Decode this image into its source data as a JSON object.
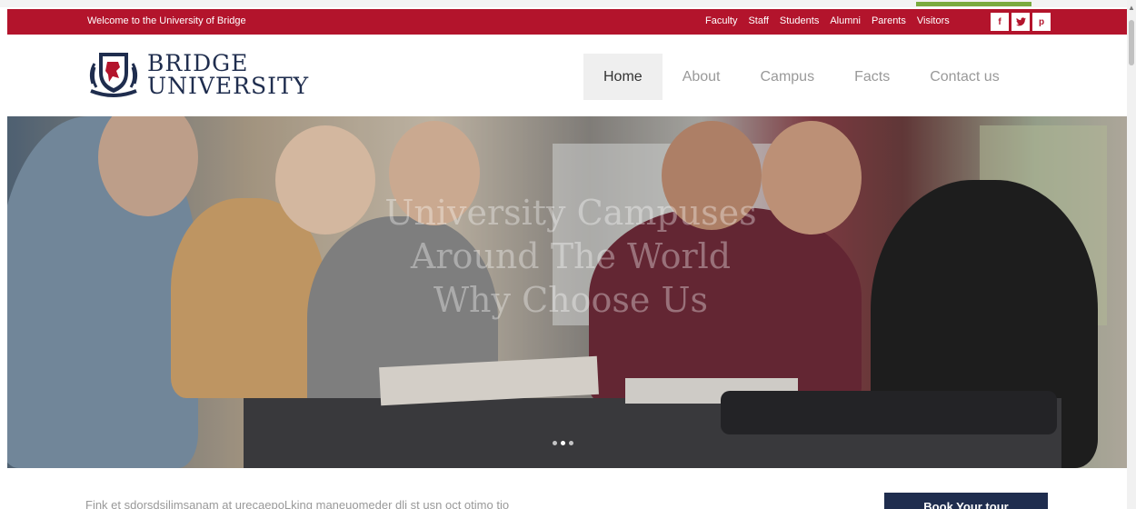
{
  "topbar": {
    "welcome": "Welcome to the University of Bridge",
    "links": [
      "Faculty",
      "Staff",
      "Students",
      "Alumni",
      "Parents",
      "Visitors"
    ],
    "social": [
      {
        "icon": "facebook-icon",
        "glyph": "f"
      },
      {
        "icon": "twitter-icon",
        "glyph": "🐦"
      },
      {
        "icon": "pinterest-icon",
        "glyph": "p"
      }
    ]
  },
  "logo": {
    "line1": "BRIDGE",
    "line2": "UNIVERSITY"
  },
  "nav": {
    "items": [
      "Home",
      "About",
      "Campus",
      "Facts",
      "Contact us"
    ],
    "active": "Home"
  },
  "hero": {
    "caption_line1": "University Campuses",
    "caption_line2": "Around The World",
    "caption_line3": "Why Choose Us",
    "slides": 3,
    "active_slide": 2
  },
  "intro": {
    "text": "Fink et sdorsdsilimsanam at urecaepoLking maneuomeder dlj st usn oct otimo tio"
  },
  "cta": {
    "label": "Book Your tour"
  },
  "colors": {
    "brand_red": "#b3142c",
    "navy": "#1f2d4e",
    "accent_green": "#7aab3e"
  }
}
